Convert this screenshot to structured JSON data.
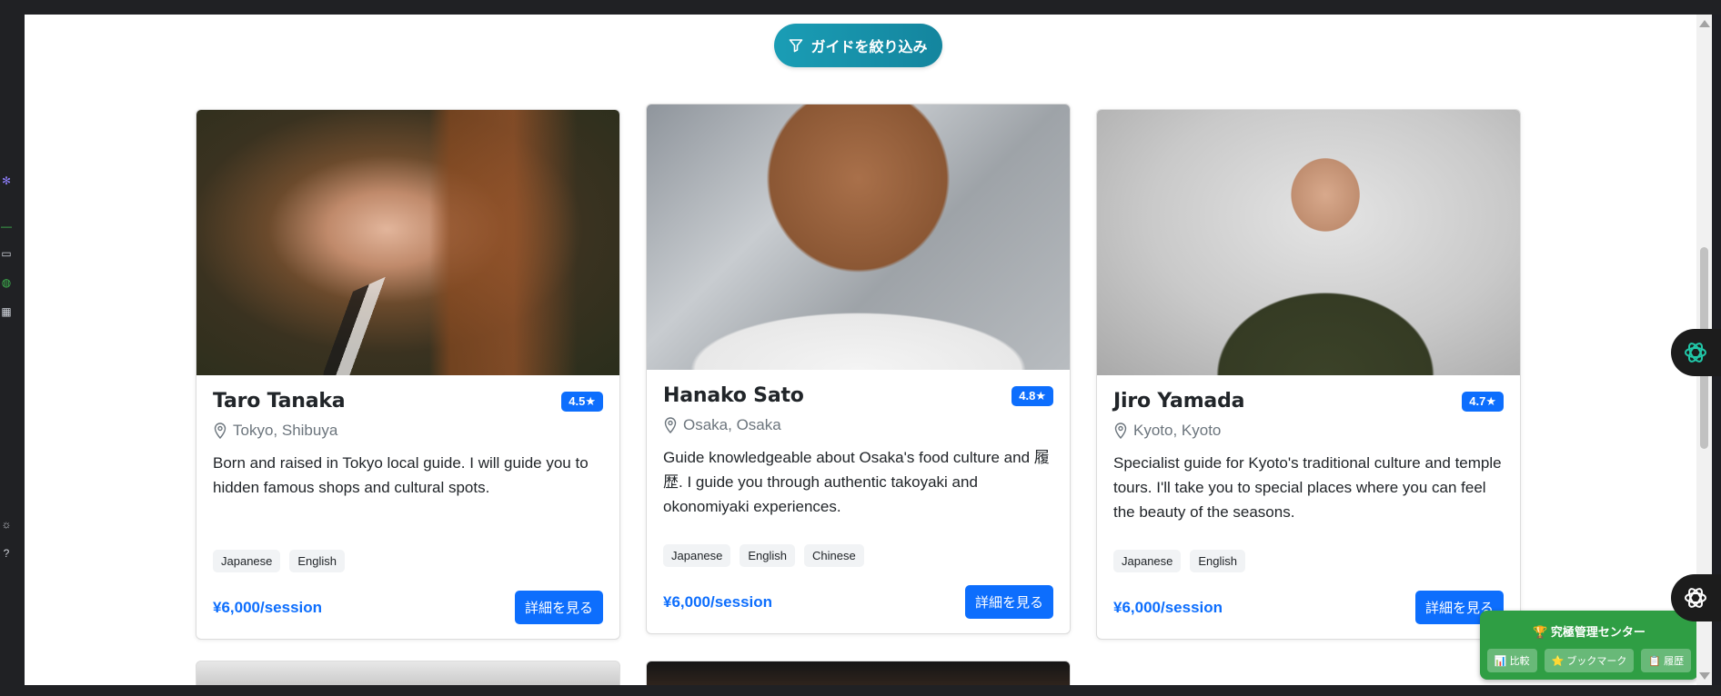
{
  "filter_button": {
    "label": "ガイドを絞り込み",
    "icon": "filter-icon"
  },
  "guides": [
    {
      "name": "Taro Tanaka",
      "rating": "4.5★",
      "location": "Tokyo, Shibuya",
      "description": "Born and raised in Tokyo local guide. I will guide you to hidden famous shops and cultural spots.",
      "languages": [
        "Japanese",
        "English"
      ],
      "price": "¥6,000/session",
      "detail_label": "詳細を見る"
    },
    {
      "name": "Hanako Sato",
      "rating": "4.8★",
      "location": "Osaka, Osaka",
      "description": "Guide knowledgeable about Osaka's food culture and 履歴. I guide you through authentic takoyaki and okonomiyaki experiences.",
      "languages": [
        "Japanese",
        "English",
        "Chinese"
      ],
      "price": "¥6,000/session",
      "detail_label": "詳細を見る"
    },
    {
      "name": "Jiro Yamada",
      "rating": "4.7★",
      "location": "Kyoto, Kyoto",
      "description": "Specialist guide for Kyoto's traditional culture and temple tours. I'll take you to special places where you can feel the beauty of the seasons.",
      "languages": [
        "Japanese",
        "English"
      ],
      "price": "¥6,000/session",
      "detail_label": "詳細を見る"
    }
  ],
  "management_widget": {
    "title": "🏆 究極管理センター",
    "buttons": [
      "📊 比較",
      "⭐ ブックマーク",
      "📋 履歴"
    ]
  },
  "colors": {
    "primary": "#0d6efd",
    "filter_gradient_start": "#1a9db5",
    "widget_green": "#2f9e44"
  }
}
